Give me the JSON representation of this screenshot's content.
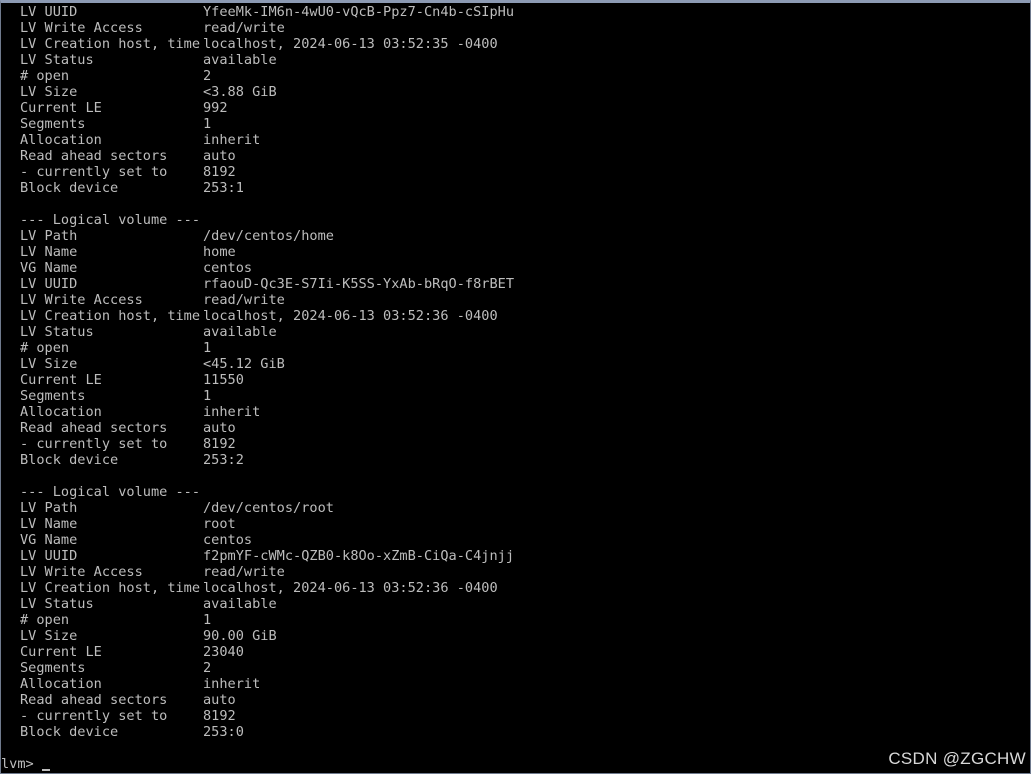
{
  "volumes": [
    {
      "fields": [
        {
          "label": "LV UUID",
          "value": "YfeeMk-IM6n-4wU0-vQcB-Ppz7-Cn4b-cSIpHu"
        },
        {
          "label": "LV Write Access",
          "value": "read/write"
        },
        {
          "label": "LV Creation host, time",
          "value": "localhost, 2024-06-13 03:52:35 -0400"
        },
        {
          "label": "LV Status",
          "value": "available"
        },
        {
          "label": "# open",
          "value": "2"
        },
        {
          "label": "LV Size",
          "value": "<3.88 GiB"
        },
        {
          "label": "Current LE",
          "value": "992"
        },
        {
          "label": "Segments",
          "value": "1"
        },
        {
          "label": "Allocation",
          "value": "inherit"
        },
        {
          "label": "Read ahead sectors",
          "value": "auto"
        },
        {
          "label": "- currently set to",
          "value": "8192"
        },
        {
          "label": "Block device",
          "value": "253:1"
        }
      ]
    },
    {
      "header": "--- Logical volume ---",
      "fields": [
        {
          "label": "LV Path",
          "value": "/dev/centos/home"
        },
        {
          "label": "LV Name",
          "value": "home"
        },
        {
          "label": "VG Name",
          "value": "centos"
        },
        {
          "label": "LV UUID",
          "value": "rfaouD-Qc3E-S7Ii-K5SS-YxAb-bRqO-f8rBET"
        },
        {
          "label": "LV Write Access",
          "value": "read/write"
        },
        {
          "label": "LV Creation host, time",
          "value": "localhost, 2024-06-13 03:52:36 -0400"
        },
        {
          "label": "LV Status",
          "value": "available"
        },
        {
          "label": "# open",
          "value": "1"
        },
        {
          "label": "LV Size",
          "value": "<45.12 GiB"
        },
        {
          "label": "Current LE",
          "value": "11550"
        },
        {
          "label": "Segments",
          "value": "1"
        },
        {
          "label": "Allocation",
          "value": "inherit"
        },
        {
          "label": "Read ahead sectors",
          "value": "auto"
        },
        {
          "label": "- currently set to",
          "value": "8192"
        },
        {
          "label": "Block device",
          "value": "253:2"
        }
      ]
    },
    {
      "header": "--- Logical volume ---",
      "fields": [
        {
          "label": "LV Path",
          "value": "/dev/centos/root"
        },
        {
          "label": "LV Name",
          "value": "root"
        },
        {
          "label": "VG Name",
          "value": "centos"
        },
        {
          "label": "LV UUID",
          "value": "f2pmYF-cWMc-QZB0-k8Oo-xZmB-CiQa-C4jnjj"
        },
        {
          "label": "LV Write Access",
          "value": "read/write"
        },
        {
          "label": "LV Creation host, time",
          "value": "localhost, 2024-06-13 03:52:36 -0400"
        },
        {
          "label": "LV Status",
          "value": "available"
        },
        {
          "label": "# open",
          "value": "1"
        },
        {
          "label": "LV Size",
          "value": "90.00 GiB"
        },
        {
          "label": "Current LE",
          "value": "23040"
        },
        {
          "label": "Segments",
          "value": "2"
        },
        {
          "label": "Allocation",
          "value": "inherit"
        },
        {
          "label": "Read ahead sectors",
          "value": "auto"
        },
        {
          "label": "- currently set to",
          "value": "8192"
        },
        {
          "label": "Block device",
          "value": "253:0"
        }
      ]
    }
  ],
  "prompt": "lvm>",
  "watermark": "CSDN @ZGCHW",
  "colors": {
    "background": "#000000",
    "text": "#bdbdbd",
    "frame": "#8c9ab3"
  }
}
